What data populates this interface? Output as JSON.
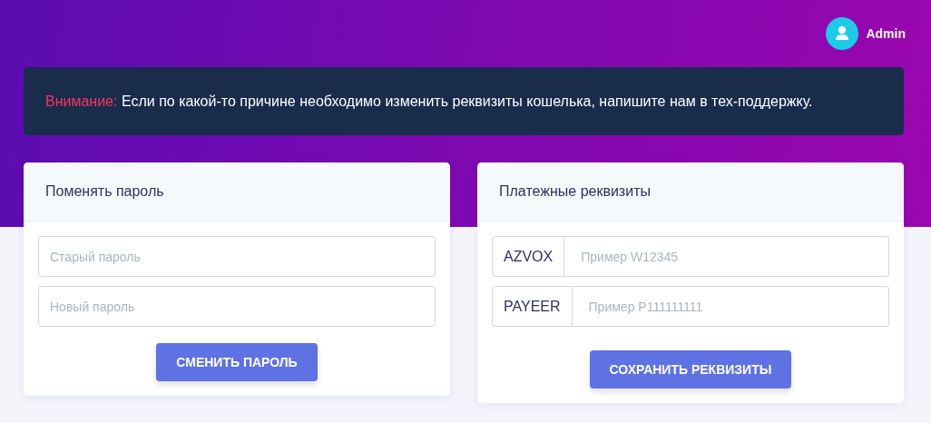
{
  "user": {
    "name": "Admin"
  },
  "alert": {
    "label": "Внимание:",
    "text": "Если по какой-то причине необходимо изменить реквизиты кошелька, напишите нам в тех-поддержку."
  },
  "password_card": {
    "title": "Поменять пароль",
    "fields": [
      {
        "placeholder": "Старый пароль"
      },
      {
        "placeholder": "Новый пароль"
      }
    ],
    "button": "СМЕНИТЬ ПАРОЛЬ"
  },
  "payment_card": {
    "title": "Платежные реквизиты",
    "fields": [
      {
        "prefix": "AZVOX",
        "placeholder": "Пример W12345"
      },
      {
        "prefix": "PAYEER",
        "placeholder": "Пример P111111111"
      }
    ],
    "button": "СОХРАНИТЬ РЕКВИЗИТЫ"
  }
}
